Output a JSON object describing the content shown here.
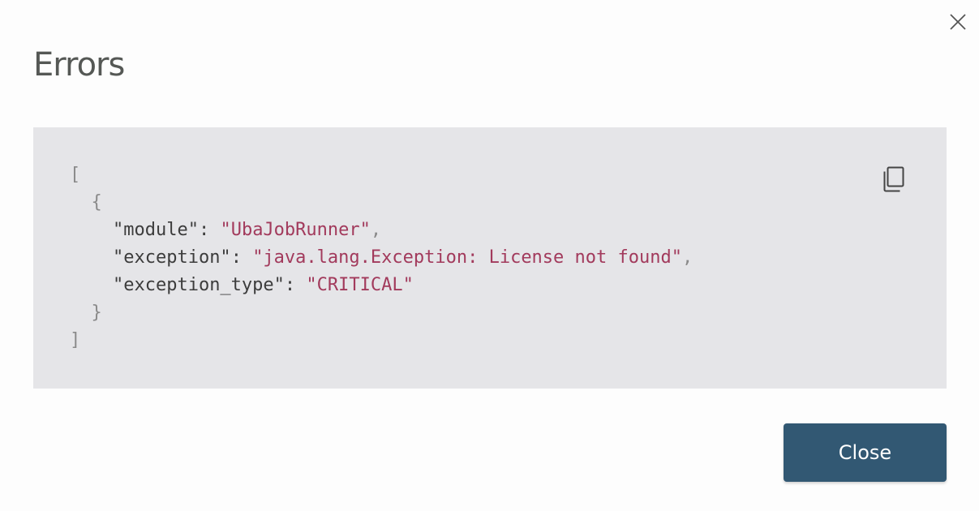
{
  "dialog": {
    "title": "Errors",
    "close_icon": "close-icon",
    "copy_icon": "copy-icon",
    "close_button_label": "Close"
  },
  "code": {
    "open_bracket": "[",
    "open_brace": "{",
    "entries": [
      {
        "key": "\"module\"",
        "value": "\"UbaJobRunner\"",
        "trailing": ","
      },
      {
        "key": "\"exception\"",
        "value": "\"java.lang.Exception: License not found\"",
        "trailing": ","
      },
      {
        "key": "\"exception_type\"",
        "value": "\"CRITICAL\"",
        "trailing": ""
      }
    ],
    "colon": ": ",
    "close_brace": "}",
    "close_bracket": "]"
  },
  "colors": {
    "background": "#fdfdfd",
    "panel": "#e5e5e8",
    "string_value": "#a23a5c",
    "button": "#325873"
  }
}
